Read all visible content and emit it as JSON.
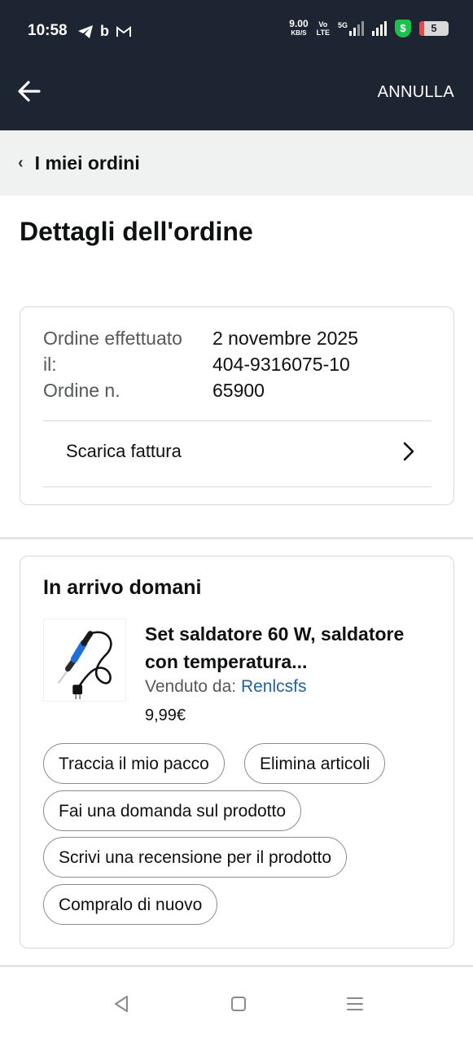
{
  "status_bar": {
    "time": "10:58",
    "app_icons": [
      "telegram-icon",
      "b-icon",
      "gmail-icon"
    ],
    "net_speed": "9.00",
    "net_speed_unit": "KB/S",
    "volte_top": "Vo",
    "volte_bottom": "LTE",
    "network_type": "5G",
    "battery_level": "5"
  },
  "header": {
    "back_icon": "arrow-left-icon",
    "cancel_label": "ANNULLA"
  },
  "breadcrumb": {
    "label": "I miei ordini"
  },
  "page": {
    "title": "Dettagli dell'ordine"
  },
  "order_info": {
    "date_label": "Ordine effettuato il:",
    "number_label": "Ordine n.",
    "date_value": "2 novembre 2025",
    "number_value": "404-9316075-1065900",
    "invoice_label": "Scarica fattura"
  },
  "shipment": {
    "status": "In arrivo domani",
    "product_title": "Set saldatore 60 W, saldatore con temperatura...",
    "seller_prefix": "Venduto da:",
    "seller_name": "Renlcsfs",
    "price": "9,99€",
    "actions": {
      "track": "Traccia il mio pacco",
      "remove": "Elimina articoli",
      "question": "Fai una domanda sul prodotto",
      "review": "Scrivi una recensione per il prodotto",
      "buy_again": "Compralo di nuovo"
    }
  },
  "colors": {
    "header_bg": "#1d2532",
    "breadcrumb_bg": "#f0f2f2",
    "link": "#2162a1",
    "shield": "#1fbf4f"
  }
}
